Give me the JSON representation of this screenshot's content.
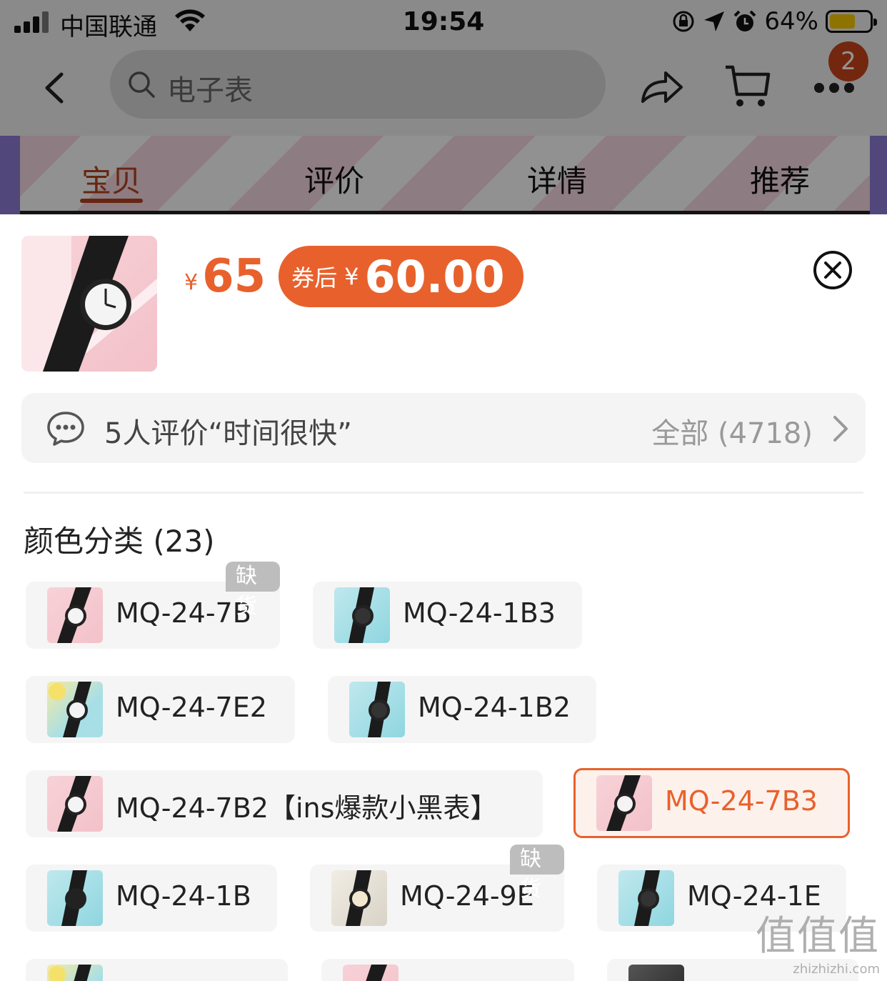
{
  "status_bar": {
    "carrier": "中国联通",
    "time": "19:54",
    "battery_percent": "64%",
    "battery_level": 0.64,
    "battery_color": "#f7c600"
  },
  "nav": {
    "search_placeholder": "电子表",
    "cart_badge": "2",
    "icons": [
      "back-icon",
      "search-icon",
      "share-icon",
      "cart-icon",
      "more-icon"
    ]
  },
  "tabs": [
    {
      "label": "宝贝",
      "active": true
    },
    {
      "label": "评价",
      "active": false
    },
    {
      "label": "详情",
      "active": false
    },
    {
      "label": "推荐",
      "active": false
    }
  ],
  "product": {
    "price_currency": "¥",
    "price": "65",
    "coupon_label": "券后",
    "coupon_currency": "¥",
    "coupon_price": "60.00",
    "accent_color": "#e8612c"
  },
  "reviews": {
    "summary": "5人评价“时间很快”",
    "all_label": "全部 (4718)"
  },
  "options": {
    "title": "颜色分类 (23)",
    "items": [
      {
        "label": "MQ-24-7B",
        "tag": "缺货",
        "selected": false
      },
      {
        "label": "MQ-24-1B3",
        "tag": "",
        "selected": false
      },
      {
        "label": "MQ-24-7E2",
        "tag": "",
        "selected": false
      },
      {
        "label": "MQ-24-1B2",
        "tag": "",
        "selected": false
      },
      {
        "label": "MQ-24-7B2【ins爆款小黑表】",
        "tag": "",
        "selected": false
      },
      {
        "label": "MQ-24-7B3",
        "tag": "",
        "selected": true
      },
      {
        "label": "MQ-24-1B",
        "tag": "",
        "selected": false
      },
      {
        "label": "MQ-24-9E",
        "tag": "缺货",
        "selected": false
      },
      {
        "label": "MQ-24-1E",
        "tag": "",
        "selected": false
      }
    ]
  },
  "watermark": {
    "logo": "值值值",
    "url": "zhizhizhi.com"
  }
}
